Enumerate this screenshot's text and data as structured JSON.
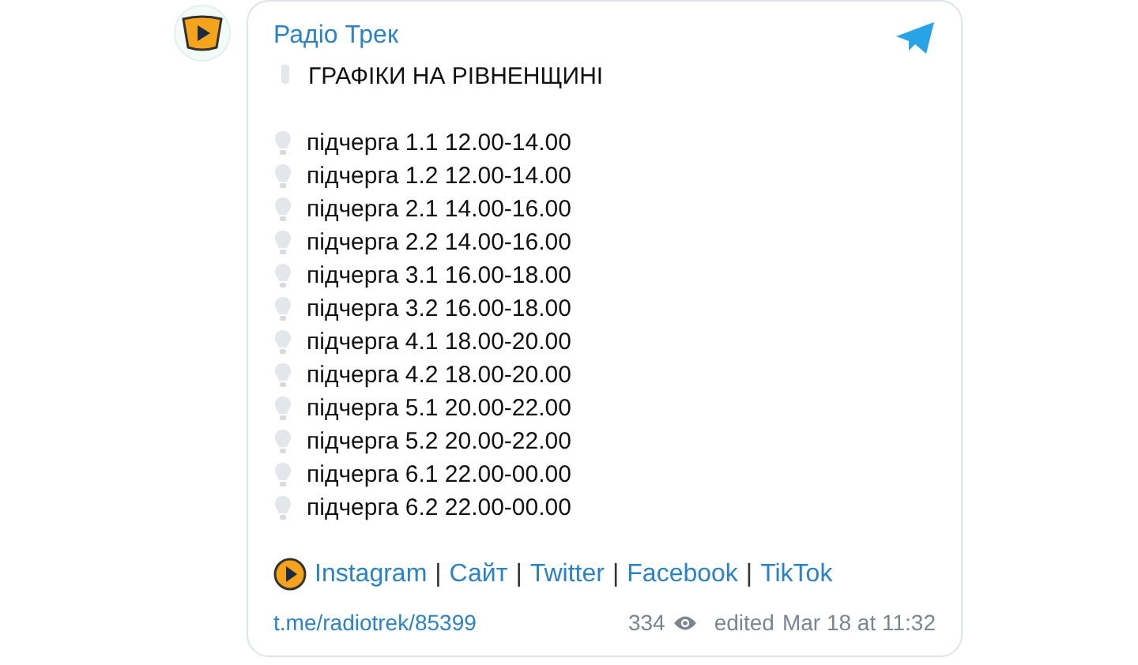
{
  "channel": {
    "name": "Радіо Трек"
  },
  "post": {
    "heading": "ГРАФІКИ НА РІВНЕНЩИНІ",
    "items": [
      "підчерга 1.1 12.00-14.00",
      "підчерга 1.2 12.00-14.00",
      "підчерга 2.1 14.00-16.00",
      "підчерга 2.2 14.00-16.00",
      "підчерга 3.1 16.00-18.00",
      "підчерга 3.2 16.00-18.00",
      "підчерга 4.1 18.00-20.00",
      "підчерга 4.2 18.00-20.00",
      "підчерга 5.1 20.00-22.00",
      "підчерга 5.2 20.00-22.00",
      "підчерга 6.1 22.00-00.00",
      "підчерга 6.2 22.00-00.00"
    ],
    "links": [
      "Instagram",
      "Сайт",
      "Twitter",
      "Facebook",
      "TikTok"
    ],
    "separator": "|"
  },
  "footer": {
    "link": "t.me/radiotrek/85399",
    "views": "334",
    "edited": "edited",
    "time": "Mar 18 at 11:32"
  }
}
